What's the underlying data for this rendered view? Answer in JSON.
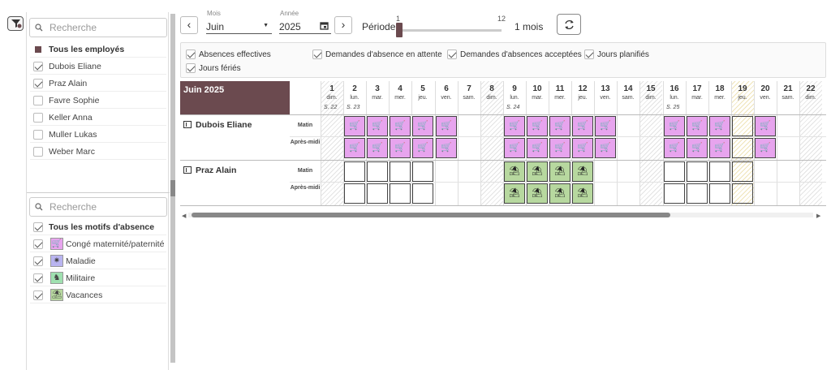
{
  "search": {
    "placeholder": "Recherche"
  },
  "employees": {
    "all_label": "Tous les employés",
    "items": [
      {
        "name": "Dubois Eliane",
        "checked": true
      },
      {
        "name": "Praz Alain",
        "checked": true
      },
      {
        "name": "Favre Sophie",
        "checked": false
      },
      {
        "name": "Keller Anna",
        "checked": false
      },
      {
        "name": "Muller Lukas",
        "checked": false
      },
      {
        "name": "Weber Marc",
        "checked": false
      }
    ]
  },
  "motifs": {
    "all_label": "Tous les motifs d'absence",
    "items": [
      {
        "name": "Congé maternité/paternité",
        "icon": "stroller-icon",
        "glyph": "🛒",
        "color": "#e7a4ee",
        "checked": true
      },
      {
        "name": "Maladie",
        "icon": "bacteria-icon",
        "glyph": "✷",
        "color": "#b9b4f0",
        "checked": true
      },
      {
        "name": "Militaire",
        "icon": "soldier-icon",
        "glyph": "♞",
        "color": "#9fe0b0",
        "checked": true
      },
      {
        "name": "Vacances",
        "icon": "palm-tree-icon",
        "glyph": "⛱",
        "color": "#b7d89f",
        "checked": true
      }
    ]
  },
  "toolbar": {
    "mois_label": "Mois",
    "mois_value": "Juin",
    "annee_label": "Année",
    "annee_value": "2025",
    "periode_label": "Période",
    "slider_min": "1",
    "slider_max": "12",
    "slider_value": 1,
    "period_value": "1 mois"
  },
  "legend": [
    {
      "label": "Absences effectives",
      "checked": true
    },
    {
      "label": "Demandes d'absence en attente",
      "checked": true
    },
    {
      "label": "Demandes d'absences acceptées",
      "checked": true
    },
    {
      "label": "Jours planifiés",
      "checked": true
    },
    {
      "label": "Jours fériés",
      "checked": true
    }
  ],
  "calendar": {
    "month_title": "Juin 2025",
    "days": [
      {
        "num": "1",
        "name": "dim.",
        "week": "S. 22",
        "type": "weekend"
      },
      {
        "num": "2",
        "name": "lun.",
        "week": "S. 23",
        "type": ""
      },
      {
        "num": "3",
        "name": "mar.",
        "week": "",
        "type": ""
      },
      {
        "num": "4",
        "name": "mer.",
        "week": "",
        "type": ""
      },
      {
        "num": "5",
        "name": "jeu.",
        "week": "",
        "type": ""
      },
      {
        "num": "6",
        "name": "ven.",
        "week": "",
        "type": ""
      },
      {
        "num": "7",
        "name": "sam.",
        "week": "",
        "type": ""
      },
      {
        "num": "8",
        "name": "dim.",
        "week": "",
        "type": "weekend"
      },
      {
        "num": "9",
        "name": "lun.",
        "week": "S. 24",
        "type": ""
      },
      {
        "num": "10",
        "name": "mar.",
        "week": "",
        "type": ""
      },
      {
        "num": "11",
        "name": "mer.",
        "week": "",
        "type": ""
      },
      {
        "num": "12",
        "name": "jeu.",
        "week": "",
        "type": ""
      },
      {
        "num": "13",
        "name": "ven.",
        "week": "",
        "type": ""
      },
      {
        "num": "14",
        "name": "sam.",
        "week": "",
        "type": ""
      },
      {
        "num": "15",
        "name": "dim.",
        "week": "",
        "type": "weekend"
      },
      {
        "num": "16",
        "name": "lun.",
        "week": "S. 25",
        "type": ""
      },
      {
        "num": "17",
        "name": "mar.",
        "week": "",
        "type": ""
      },
      {
        "num": "18",
        "name": "mer.",
        "week": "",
        "type": ""
      },
      {
        "num": "19",
        "name": "jeu.",
        "week": "",
        "type": "holiday"
      },
      {
        "num": "20",
        "name": "ven.",
        "week": "",
        "type": ""
      },
      {
        "num": "21",
        "name": "sam.",
        "week": "",
        "type": ""
      },
      {
        "num": "22",
        "name": "dim.",
        "week": "",
        "type": "weekend"
      }
    ],
    "half_day_labels": {
      "morning": "Matin",
      "afternoon": "Après-midi"
    },
    "rows": [
      {
        "employee": "Dubois Eliane",
        "morning": [
          "",
          "M",
          "M",
          "M",
          "M",
          "M",
          "",
          "",
          "M",
          "M",
          "M",
          "M",
          "M",
          "",
          "",
          "M",
          "M",
          "M",
          "P",
          "M",
          "",
          ""
        ],
        "afternoon": [
          "",
          "M",
          "M",
          "M",
          "M",
          "M",
          "",
          "",
          "M",
          "M",
          "M",
          "M",
          "M",
          "",
          "",
          "M",
          "M",
          "M",
          "P",
          "M",
          "",
          ""
        ]
      },
      {
        "employee": "Praz Alain",
        "morning": [
          "",
          "E",
          "E",
          "E",
          "E",
          "",
          "",
          "",
          "V",
          "V",
          "V",
          "V",
          "",
          "",
          "",
          "E",
          "E",
          "E",
          "P",
          "",
          "",
          ""
        ],
        "afternoon": [
          "",
          "E",
          "E",
          "E",
          "E",
          "",
          "",
          "",
          "V",
          "V",
          "V",
          "V",
          "",
          "",
          "",
          "E",
          "E",
          "E",
          "P",
          "",
          "",
          ""
        ]
      }
    ],
    "cell_legend": {
      "M": "Congé maternité/paternité",
      "V": "Vacances",
      "E": "Jours planifiés",
      "P": "Jours fériés"
    }
  },
  "colors": {
    "brand": "#6b4a4f",
    "maternity": "#e7a4ee",
    "vacation": "#b7d89f",
    "holiday": "#efe4b8"
  }
}
